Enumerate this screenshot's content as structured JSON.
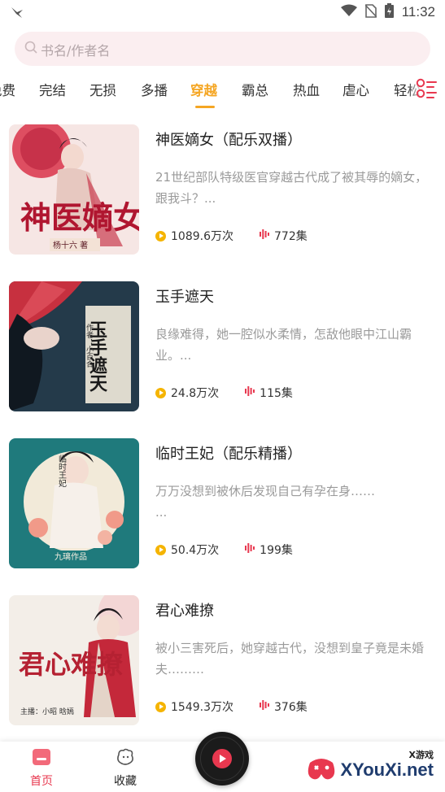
{
  "status_bar": {
    "time": "11:32"
  },
  "search": {
    "placeholder": "书名/作者名"
  },
  "tabs": [
    {
      "label": "免费"
    },
    {
      "label": "完结"
    },
    {
      "label": "无损"
    },
    {
      "label": "多播"
    },
    {
      "label": "穿越",
      "active": true
    },
    {
      "label": "霸总"
    },
    {
      "label": "热血"
    },
    {
      "label": "虐心"
    },
    {
      "label": "轻松"
    }
  ],
  "books": [
    {
      "title": "神医嫡女（配乐双播）",
      "desc": "21世纪部队特级医官穿越古代成了被其辱的嫡女，跟我斗？...",
      "plays": "1089.6万次",
      "episodes": "772集",
      "cover_text": "神医嫡女",
      "cover_author": "杨十六 著"
    },
    {
      "title": "玉手遮天",
      "desc": "良缘难得，她一腔似水柔情，怎敌他眼中江山霸业。...",
      "plays": "24.8万次",
      "episodes": "115集",
      "cover_text": "玉手遮天",
      "cover_author": "作者：小百合"
    },
    {
      "title": "临时王妃（配乐精播）",
      "desc": "万万没想到被休后发现自己有孕在身……\n...",
      "plays": "50.4万次",
      "episodes": "199集",
      "cover_text": "临时王妃",
      "cover_author": "九璃作品"
    },
    {
      "title": "君心难撩",
      "desc": "被小三害死后，她穿越古代，没想到皇子竟是未婚夫………",
      "plays": "1549.3万次",
      "episodes": "376集",
      "cover_text": "君心难撩",
      "cover_author": "主播：小昭 晗嫣"
    }
  ],
  "bottom_nav": {
    "home": "首页",
    "favorites": "收藏"
  },
  "watermark": {
    "brand": "XYouXi.net",
    "sub": "X游戏"
  },
  "colors": {
    "accent": "#f5a623",
    "pink": "#e8384f",
    "search_bg": "#fbeef0"
  }
}
